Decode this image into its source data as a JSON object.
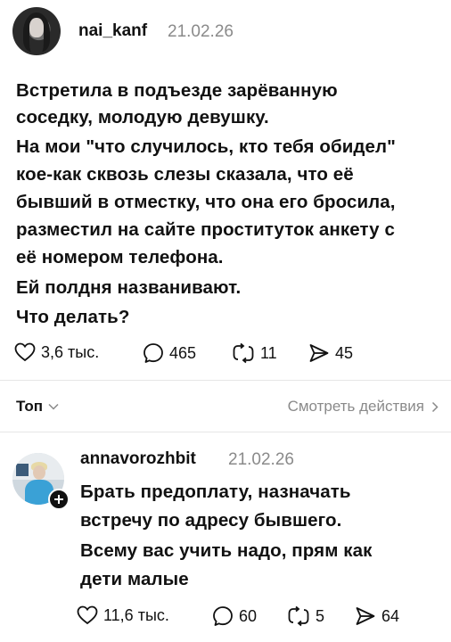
{
  "post": {
    "username": "nai_kanf",
    "date": "21.02.26",
    "text_lines": [
      "Встретила в подъезде зарёванную",
      "соседку, молодую девушку.",
      "На мои \"что случилось, кто тебя обидел\"",
      "кое-как сквозь слезы сказала, что её",
      "бывший в отместку, что она его бросила,",
      "разместил на сайте проституток анкету с",
      "её номером телефона.",
      "Ей полдня названивают.",
      "Что делать?"
    ],
    "likes": "3,6 тыс.",
    "comments": "465",
    "reposts": "11",
    "shares": "45"
  },
  "replies_header": {
    "sort_label": "Топ",
    "activity_label": "Смотреть действия"
  },
  "reply": {
    "username": "annavorozhbit",
    "date": "21.02.26",
    "text_lines": [
      "Брать предоплату, назначать",
      "встречу по адресу бывшего.",
      "Всему вас учить надо, прям как",
      "дети малые"
    ],
    "likes": "11,6 тыс.",
    "comments": "60",
    "reposts": "5",
    "shares": "64"
  },
  "icons": {
    "like": "heart-icon",
    "comment": "comment-bubble-icon",
    "repost": "repost-icon",
    "share": "send-icon",
    "sort": "chevron-down-icon",
    "activity": "chevron-right-icon",
    "follow": "plus-icon"
  }
}
